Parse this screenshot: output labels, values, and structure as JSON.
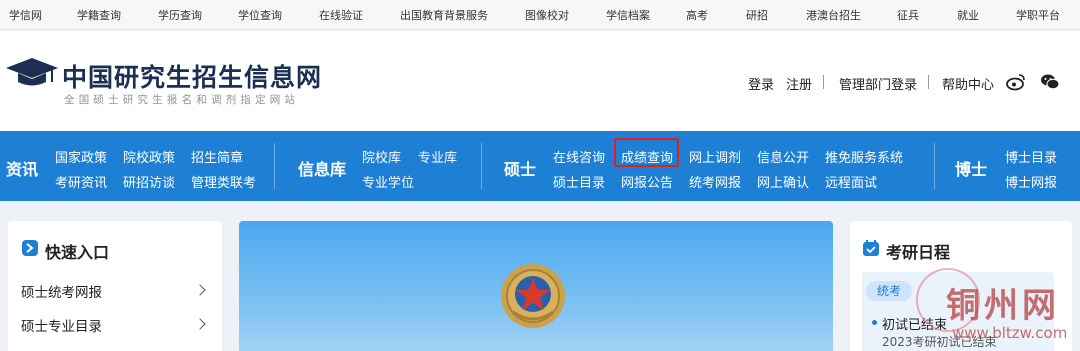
{
  "top_nav": [
    "学信网",
    "学籍查询",
    "学历查询",
    "学位查询",
    "在线验证",
    "出国教育背景服务",
    "图像校对",
    "学信档案",
    "高考",
    "研招",
    "港澳台招生",
    "征兵",
    "就业",
    "学职平台"
  ],
  "header": {
    "title": "中国研究生招生信息网",
    "subtitle": "全国硕士研究生报名和调剂指定网站",
    "login": "登录",
    "register": "注册",
    "admin_login": "管理部门登录",
    "help": "帮助中心",
    "weibo_icon": "weibo-icon",
    "wechat_icon": "wechat-icon"
  },
  "blue_nav": {
    "sections": [
      "资讯",
      "信息库",
      "硕士",
      "博士"
    ],
    "zixun": [
      "国家政策",
      "院校政策",
      "招生简章",
      "考研资讯",
      "研招访谈",
      "管理类联考"
    ],
    "xinxiku": [
      "院校库",
      "专业库",
      "专业学位"
    ],
    "shuoshi": [
      "在线咨询",
      "成绩查询",
      "网上调剂",
      "信息公开",
      "推免服务系统",
      "硕士目录",
      "网报公告",
      "统考网报",
      "网上确认",
      "远程面试"
    ],
    "boshi": [
      "博士目录",
      "博士网报"
    ],
    "highlight_color": "#e02020",
    "bar_color": "#1e80d4"
  },
  "quick_entry": {
    "title": "快速入口",
    "items": [
      "硕士统考网报",
      "硕士专业目录"
    ]
  },
  "schedule": {
    "title": "考研日程",
    "tab": "统考",
    "item_main": "初试已结束",
    "item_sub": "2023考研初试已结束"
  },
  "watermark": {
    "text": "铜州网",
    "url": "www.bltzw.com"
  }
}
